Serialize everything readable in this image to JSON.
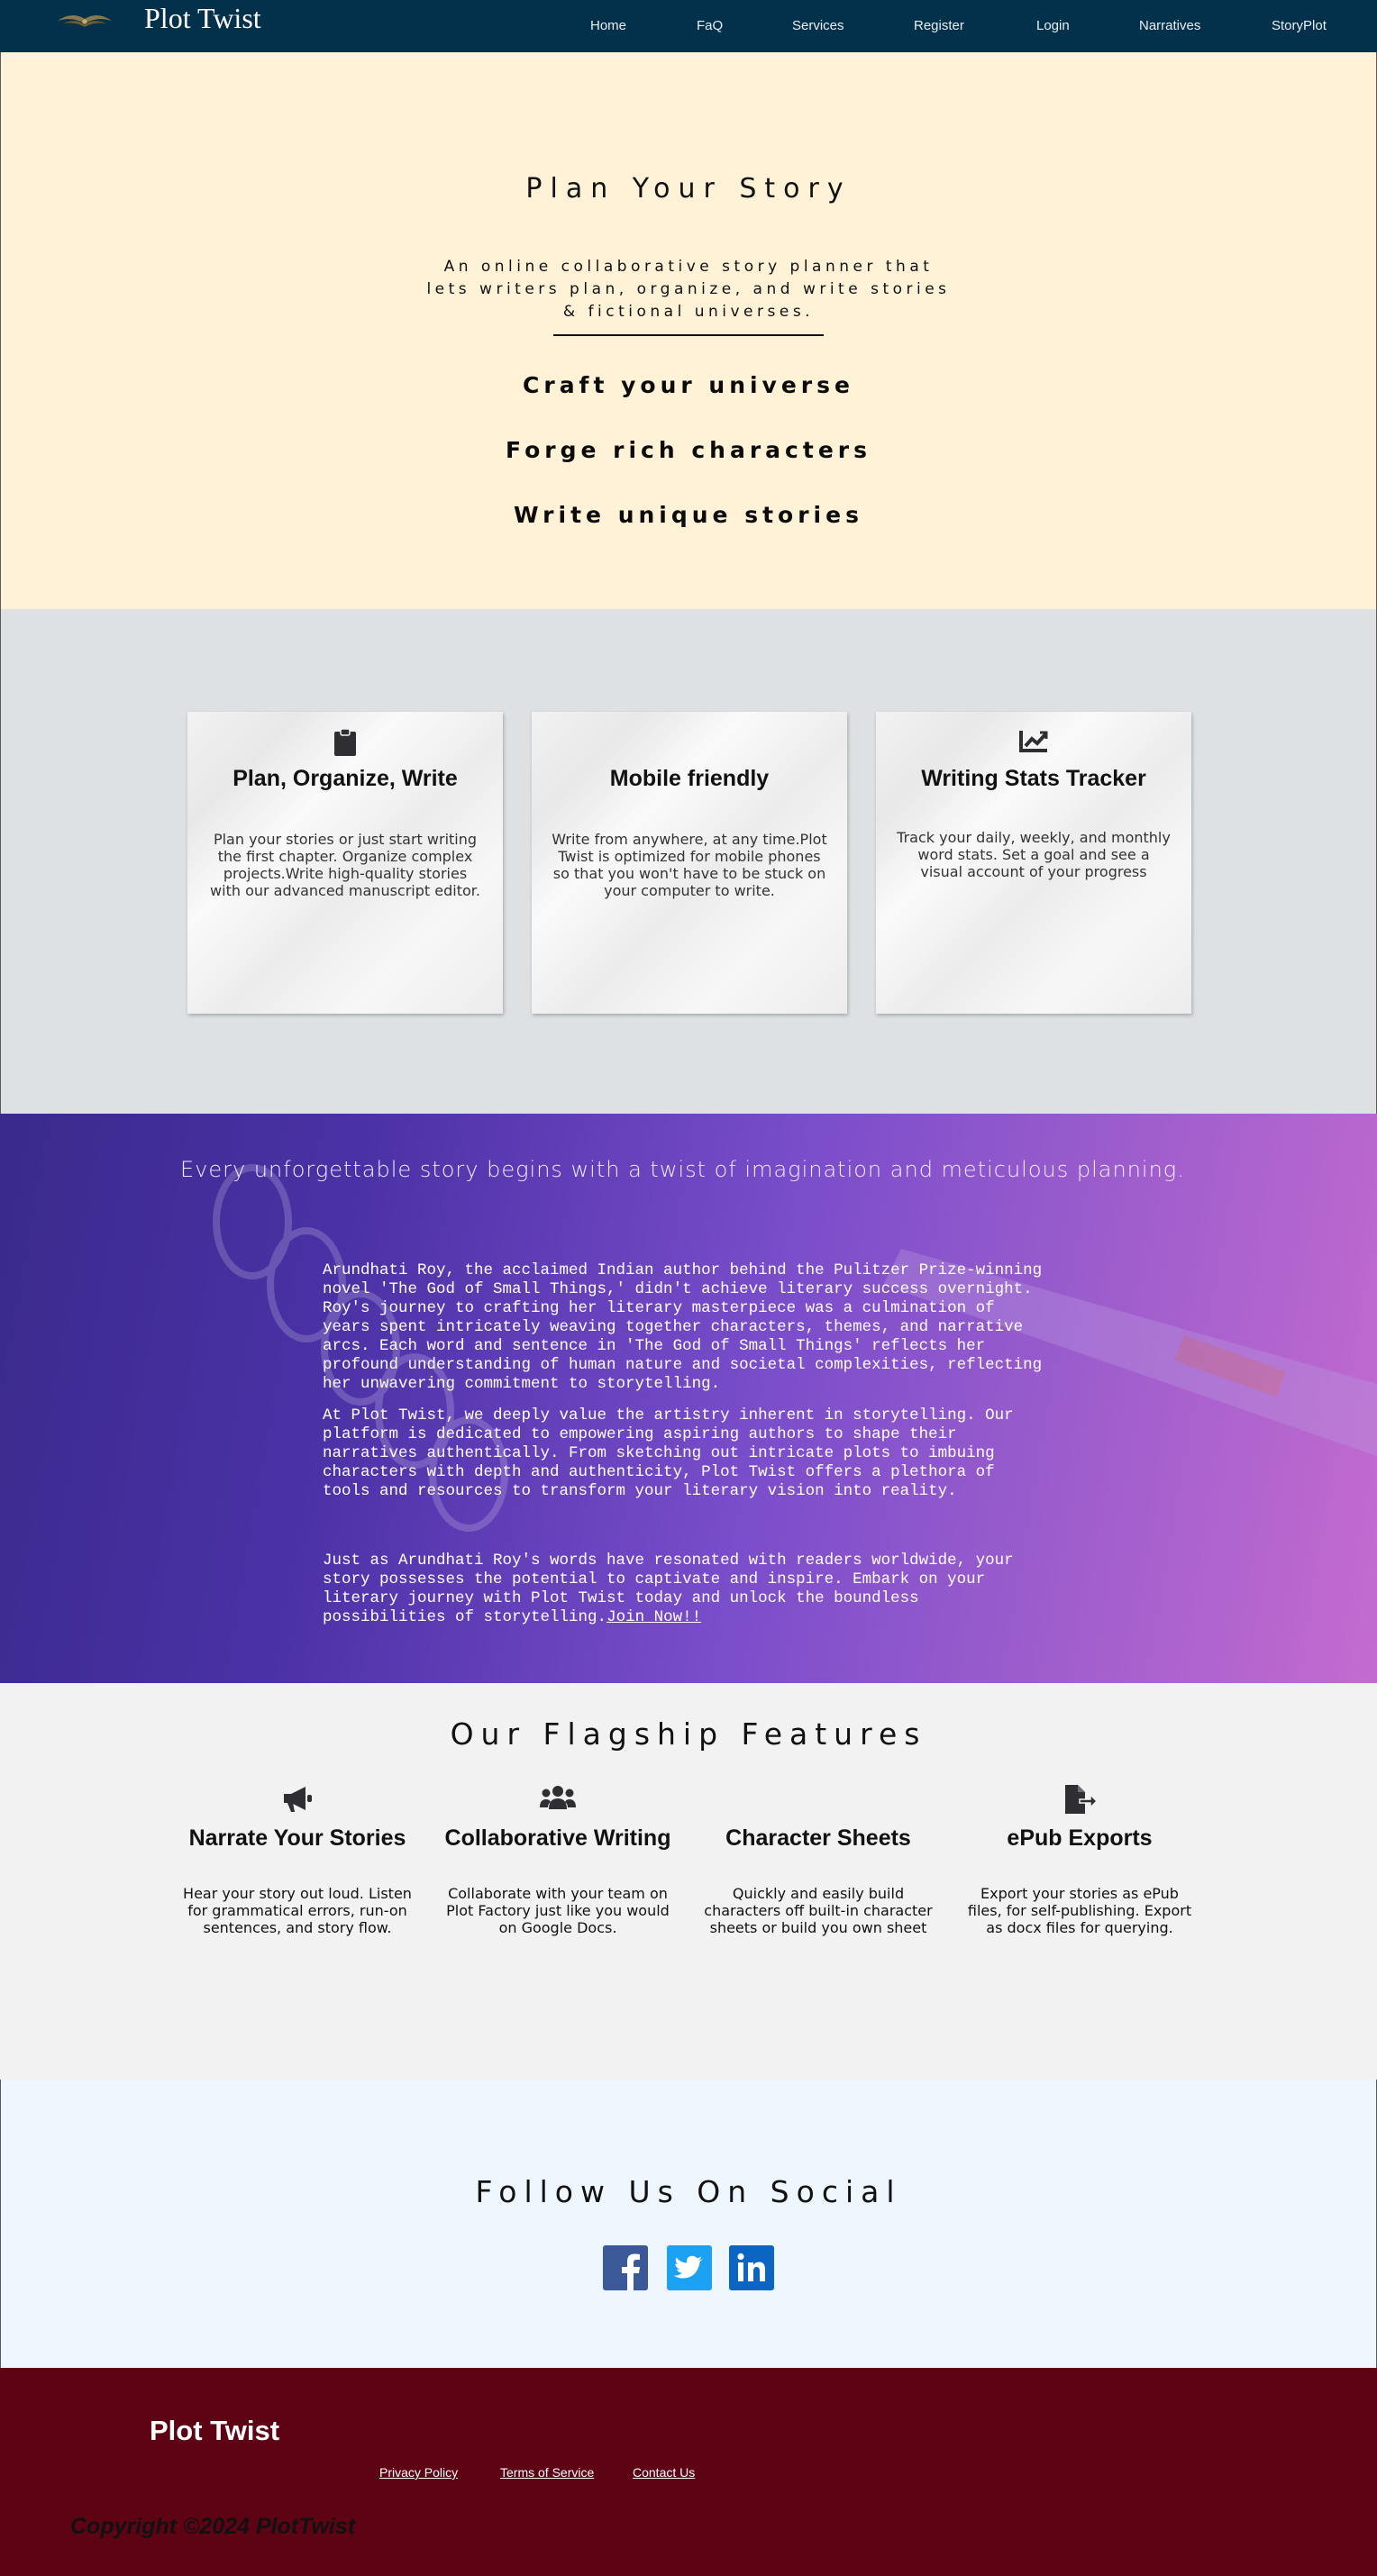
{
  "nav": {
    "brand": "Plot Twist",
    "links": [
      "Home",
      "FaQ",
      "Services",
      "Register",
      "Login",
      "Narratives",
      "StoryPlot"
    ]
  },
  "hero": {
    "title": "Plan Your Story",
    "subtitle": "An online collaborative story planner that lets writers plan, organize, and write stories & fictional universes.",
    "points": [
      "Craft your universe",
      "Forge rich characters",
      "Write unique stories"
    ]
  },
  "cards": [
    {
      "icon": "clipboard-icon",
      "title": "Plan, Organize, Write",
      "text": "Plan your stories or just start writing the first chapter. Organize complex projects.Write high-quality stories with our advanced manuscript editor."
    },
    {
      "icon": "mobile-icon",
      "title": "Mobile friendly",
      "text": "Write from anywhere, at any time.Plot Twist is optimized for mobile phones so that you won't have to be stuck on your computer to write."
    },
    {
      "icon": "chart-line-icon",
      "title": "Writing Stats Tracker",
      "text": "Track your daily, weekly, and monthly word stats. Set a goal and see a visual account of your progress"
    }
  ],
  "story": {
    "heading": "Every unforgettable story begins with a twist of imagination and meticulous planning.",
    "p1": "Arundhati Roy, the acclaimed Indian author behind the Pulitzer Prize-winning novel 'The God of Small Things,' didn't achieve literary success overnight. Roy's journey to crafting her literary masterpiece was a culmination of years spent intricately weaving together characters, themes, and narrative arcs. Each word and sentence in 'The God of Small Things' reflects her profound understanding of human nature and societal complexities, reflecting her unwavering commitment to storytelling.",
    "p2": "At Plot Twist, we deeply value the artistry inherent in storytelling. Our platform is dedicated to empowering aspiring authors to shape their narratives authentically. From sketching out intricate plots to imbuing characters with depth and authenticity, Plot Twist offers a plethora of tools and resources to transform your literary vision into reality.",
    "p3": "Just as Arundhati Roy's words have resonated with readers worldwide, your story possesses the potential to captivate and inspire. Embark on your literary journey with Plot Twist today and unlock the boundless possibilities of storytelling.",
    "join": "Join Now!!"
  },
  "features": {
    "title": "Our Flagship Features",
    "items": [
      {
        "icon": "megaphone-icon",
        "title": "Narrate Your Stories",
        "text": "Hear your story out loud. Listen for grammatical errors, run-on sentences, and story flow."
      },
      {
        "icon": "users-icon",
        "title": "Collaborative Writing",
        "text": "Collaborate with your team on Plot Factory just like you would on Google Docs."
      },
      {
        "icon": "",
        "title": "Character Sheets",
        "text": "Quickly and easily build characters off built-in character sheets or build you own sheet"
      },
      {
        "icon": "file-export-icon",
        "title": "ePub Exports",
        "text": "Export your stories as ePub files, for self-publishing. Export as docx files for querying."
      }
    ]
  },
  "social": {
    "title": "Follow Us On Social",
    "icons": [
      "facebook-icon",
      "twitter-icon",
      "linkedin-icon"
    ],
    "colors": {
      "facebook": "#3b5998",
      "twitter": "#1da1f2",
      "linkedin": "#0a66c2"
    }
  },
  "footer": {
    "brand": "Plot Twist",
    "links": [
      "Privacy Policy",
      "Terms of Service",
      "Contact Us"
    ],
    "copyright": "Copyright ©2024 PlotTwist"
  },
  "colors": {
    "nav": "#03314b",
    "hero": "#fff2d6",
    "cards_bg": "#dee1e3",
    "features_bg": "#f2f2f2",
    "social_bg": "#eef7fd",
    "footer": "#5e0314"
  }
}
